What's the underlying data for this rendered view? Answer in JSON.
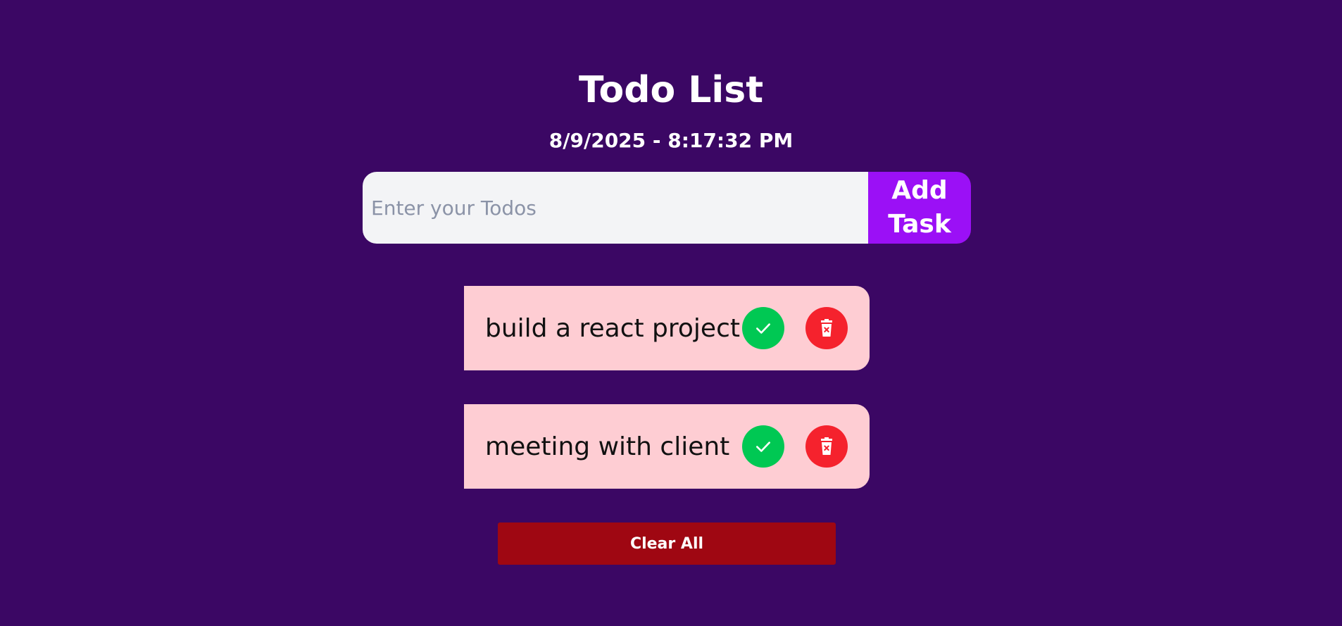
{
  "header": {
    "title": "Todo List",
    "datetime": "8/9/2025 - 8:17:32 PM"
  },
  "form": {
    "input_value": "",
    "input_placeholder": "Enter your Todos",
    "add_label": "Add Task"
  },
  "todos": [
    {
      "text": "build a react project",
      "check_icon": "check-icon",
      "delete_icon": "trash-icon"
    },
    {
      "text": "meeting with client",
      "check_icon": "check-icon",
      "delete_icon": "trash-icon"
    }
  ],
  "actions": {
    "clear_label": "Clear All"
  },
  "colors": {
    "background": "#3b0764",
    "accent": "#9b10f6",
    "item_background": "#fecdd3",
    "check": "#00c853",
    "delete": "#f5222d",
    "clear": "#9f0712"
  }
}
